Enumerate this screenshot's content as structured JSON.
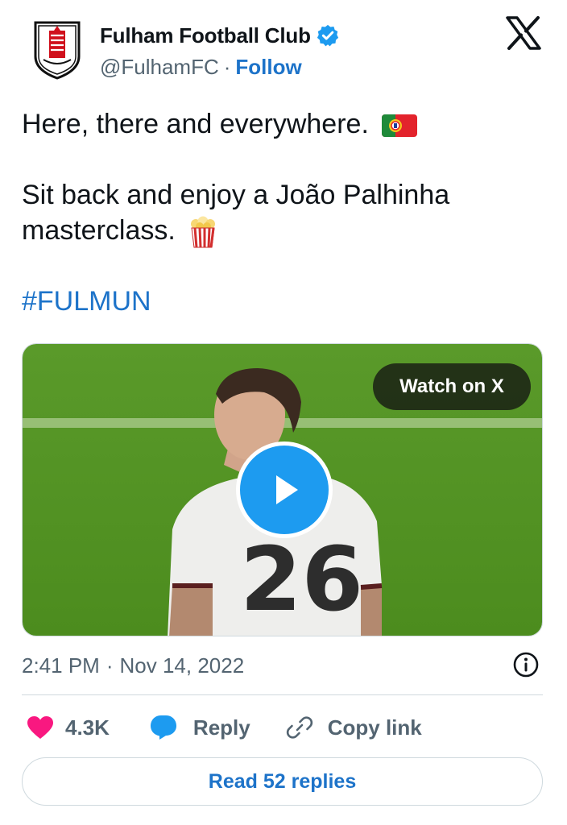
{
  "author": {
    "display_name": "Fulham Football Club",
    "handle": "@FulhamFC",
    "separator": "·",
    "follow_label": "Follow",
    "verified": true
  },
  "brand": {
    "logo_icon": "x-logo-icon",
    "avatar_icon": "fulham-crest-icon"
  },
  "tweet": {
    "line1": "Here, there and everywhere.",
    "line1_emoji": "portugal-flag-icon",
    "line2": "Sit back and enjoy a João Palhinha masterclass.",
    "line2_emoji": "popcorn-icon",
    "hashtag": "#FULMUN"
  },
  "media": {
    "type": "video",
    "watch_label": "Watch on X",
    "play_icon": "play-icon",
    "jersey_number": "26"
  },
  "meta": {
    "time": "2:41 PM",
    "separator": "·",
    "date": "Nov 14, 2022",
    "info_icon": "info-icon"
  },
  "actions": {
    "like_count": "4.3K",
    "reply_label": "Reply",
    "copy_link_label": "Copy link",
    "read_replies_label": "Read 52 replies"
  },
  "colors": {
    "link": "#1d73c9",
    "verified": "#1d9bf0",
    "like": "#f91880",
    "reply_icon": "#1d9bf0",
    "text": "#0f1419",
    "secondary": "#536471",
    "border": "#cfd9de"
  }
}
